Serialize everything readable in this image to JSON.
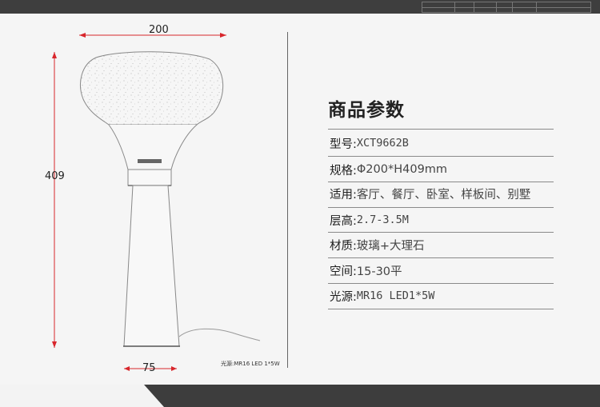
{
  "drawing": {
    "width_label": "200",
    "height_label": "409",
    "base_label": "75",
    "light_source_note": "光源:MR16 LED  1*5W"
  },
  "spec": {
    "title": "商品参数",
    "rows": [
      {
        "key": "型号:",
        "value": "XCT9662B",
        "mono": true
      },
      {
        "key": "规格:",
        "value": "Φ200*H409mm",
        "mono": false
      },
      {
        "key": "适用:",
        "value": "客厅、餐厅、卧室、样板间、别墅",
        "mono": false
      },
      {
        "key": "层高:",
        "value": "2.7-3.5M",
        "mono": true
      },
      {
        "key": "材质:",
        "value": "玻璃+大理石",
        "mono": false
      },
      {
        "key": "空间:",
        "value": "15-30平",
        "mono": false
      },
      {
        "key": "光源:",
        "value": "MR16 LED1*5W",
        "mono": true
      }
    ]
  },
  "colors": {
    "dimension_red": "#d8262c",
    "dark_bar": "#3d3d3d",
    "rule_gray": "#8a8a8a"
  }
}
